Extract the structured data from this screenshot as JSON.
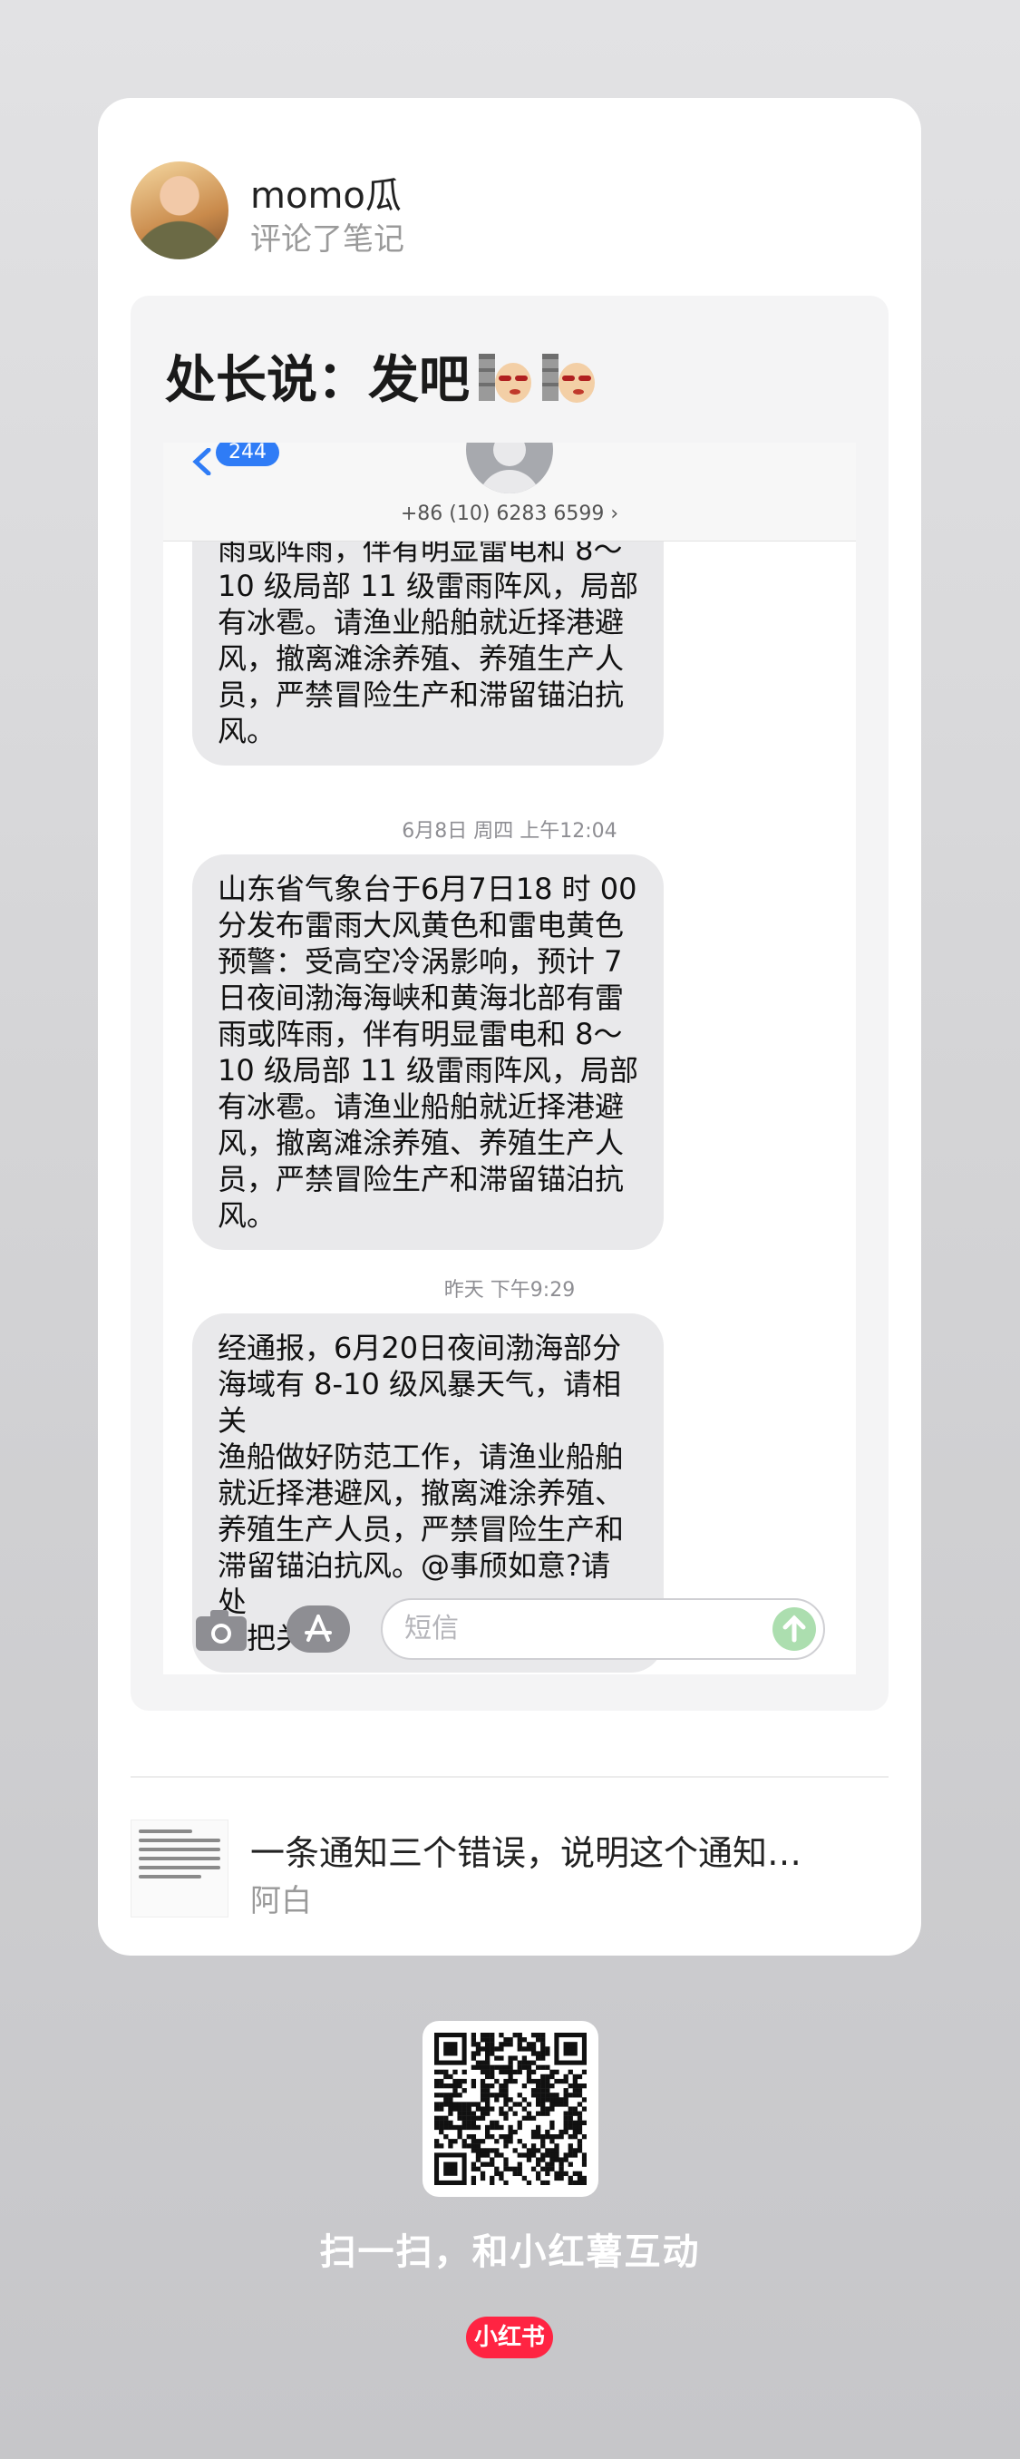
{
  "card": {
    "username": "momo瓜",
    "action": "评论了笔记",
    "comment": "处长说：发吧",
    "sticker_icons": [
      "smug-face-emoji",
      "smug-face-emoji"
    ]
  },
  "sms": {
    "back_badge": "244",
    "contact_number": "+86 (10) 6283 6599 ›",
    "messages": [
      {
        "text": "日夜间渤海海峡和黄海北部有雷\n雨或阵雨，伴有明显雷电和 8～\n10 级局部 11 级雷雨阵风，局部\n有冰雹。请渔业船舶就近择港避\n风，撤离滩涂养殖、养殖生产人\n员，严禁冒险生产和滞留锚泊抗\n风。"
      },
      {
        "timestamp": "6月8日 周四 上午12:04",
        "text": "山东省气象台于6月7日18 时 00\n分发布雷雨大风黄色和雷电黄色\n预警：受高空冷涡影响，预计 7\n日夜间渤海海峡和黄海北部有雷\n雨或阵雨，伴有明显雷电和 8～\n10 级局部 11 级雷雨阵风，局部\n有冰雹。请渔业船舶就近择港避\n风，撤离滩涂养殖、养殖生产人\n员，严禁冒险生产和滞留锚泊抗\n风。"
      },
      {
        "timestamp": "昨天 下午9:29",
        "text": "经通报，6月20日夜间渤海部分\n海域有 8-10 级风暴天气，请相关\n渔船做好防范工作，请渔业船舶\n就近择港避风，撤离滩涂养殖、\n养殖生产人员，严禁冒险生产和\n滞留锚泊抗风。@事颀如意?请处\n长把关"
      }
    ],
    "input_placeholder": "短信"
  },
  "note": {
    "title": "一条通知三个错误，说明这个通知…",
    "author": "阿白"
  },
  "footer": {
    "scan_text": "扫一扫，和小红薯互动",
    "logo_text": "小红书"
  },
  "colors": {
    "imessage_blue": "#2f7cf6",
    "bubble_gray": "#e9e9eb",
    "brand_red": "#ff2442"
  }
}
